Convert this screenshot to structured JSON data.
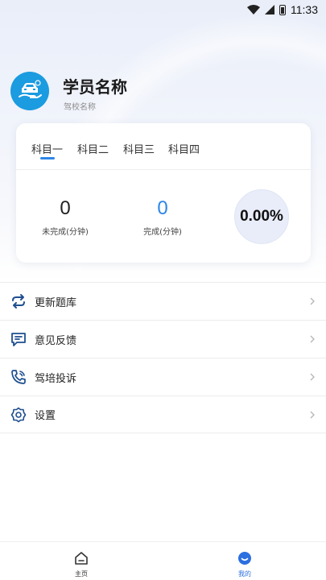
{
  "status_bar": {
    "time": "11:33",
    "icons": [
      "wifi-icon",
      "cellular-icon",
      "battery-icon"
    ]
  },
  "profile": {
    "name": "学员名称",
    "school": "驾校名称",
    "avatar_icon": "car-hand-icon",
    "avatar_color": "#1b9be0"
  },
  "subject_tabs": {
    "items": [
      "科目一",
      "科目二",
      "科目三",
      "科目四"
    ],
    "selected_index": 0,
    "accent": "#2c86e8"
  },
  "stats": {
    "incomplete": {
      "value": "0",
      "label": "未完成(分钟)"
    },
    "complete": {
      "value": "0",
      "label": "完成(分钟)",
      "color": "#2c86e8"
    },
    "progress": {
      "value": "0.00%",
      "fraction": 0.0
    }
  },
  "menu": {
    "items": [
      {
        "label": "更新题库",
        "icon": "refresh-icon"
      },
      {
        "label": "意见反馈",
        "icon": "feedback-icon"
      },
      {
        "label": "驾培投诉",
        "icon": "phone-icon"
      },
      {
        "label": "设置",
        "icon": "settings-icon"
      }
    ]
  },
  "bottom_nav": {
    "items": [
      {
        "label": "主页",
        "icon": "home-icon",
        "active": false
      },
      {
        "label": "我的",
        "icon": "profile-icon",
        "active": true
      }
    ],
    "active_color": "#2c6fe0"
  }
}
